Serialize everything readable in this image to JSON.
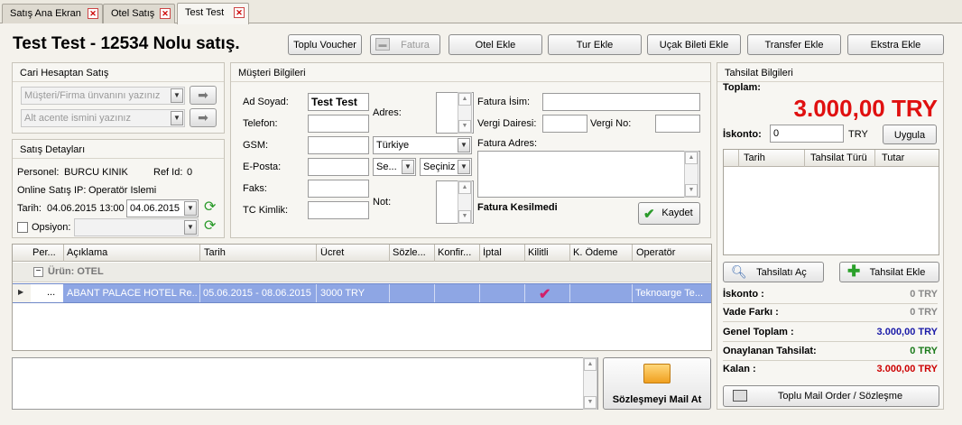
{
  "tabs": [
    {
      "label": "Satış Ana Ekran"
    },
    {
      "label": "Otel Satış"
    },
    {
      "label": "Test Test"
    }
  ],
  "page_title": "Test Test - 12534 Nolu satış.",
  "toolbar": {
    "toplu_voucher": "Toplu Voucher",
    "fatura": "Fatura",
    "otel_ekle": "Otel Ekle",
    "tur_ekle": "Tur Ekle",
    "ucak_bileti_ekle": "Uçak Bileti Ekle",
    "transfer_ekle": "Transfer Ekle",
    "ekstra_ekle": "Ekstra Ekle"
  },
  "cari": {
    "title": "Cari Hesaptan Satış",
    "firma_placeholder": "Müşteri/Firma ünvanını yazınız",
    "acente_placeholder": "Alt acente ismini yazınız"
  },
  "satis": {
    "title": "Satış Detayları",
    "personel_label": "Personel:",
    "personel_value": "BURCU KINIK",
    "refid_label": "Ref Id:",
    "refid_value": "0",
    "online_label": "Online Satış IP:",
    "online_value": "Operatör Islemi",
    "tarih_label": "Tarih:",
    "tarih_value": "04.06.2015 13:00",
    "tarih_input": "04.06.2015",
    "opsiyon_label": "Opsiyon:"
  },
  "musteri": {
    "title": "Müşteri Bilgileri",
    "ad_soyad_label": "Ad Soyad:",
    "ad_soyad_value": "Test Test",
    "telefon_label": "Telefon:",
    "gsm_label": "GSM:",
    "eposta_label": "E-Posta:",
    "faks_label": "Faks:",
    "tc_label": "TC Kimlik:",
    "adres_label": "Adres:",
    "not_label": "Not:",
    "ulke_value": "Türkiye",
    "se_value": "Se...",
    "seciniz_value": "Seçiniz",
    "fatura_isim_label": "Fatura İsim:",
    "vergi_dairesi_label": "Vergi Dairesi:",
    "vergi_no_label": "Vergi No:",
    "fatura_adres_label": "Fatura Adres:",
    "fatura_status": "Fatura Kesilmedi",
    "kaydet": "Kaydet"
  },
  "tahsilat": {
    "title": "Tahsilat Bilgileri",
    "toplam_label": "Toplam:",
    "toplam_value": "3.000,00 TRY",
    "iskonto_label": "İskonto:",
    "iskonto_value": "0",
    "iskonto_unit": "TRY",
    "uygula": "Uygula",
    "columns": [
      "Tarih",
      "Tahsilat Türü",
      "Tutar"
    ],
    "tahsilati_ac": "Tahsilatı Aç",
    "tahsilat_ekle": "Tahsilat Ekle",
    "summary": [
      {
        "label": "İskonto :",
        "value": "0 TRY",
        "color": "#888888"
      },
      {
        "label": "Vade Farkı :",
        "value": "0 TRY",
        "color": "#888888"
      },
      {
        "label": "Genel Toplam :",
        "value": "3.000,00 TRY",
        "color": "#1a1aa8"
      },
      {
        "label": "Onaylanan Tahsilat:",
        "value": "0 TRY",
        "color": "#1a7a1a"
      },
      {
        "label": "Kalan :",
        "value": "3.000,00 TRY",
        "color": "#cc0000"
      }
    ],
    "toplu_mail": "Toplu Mail Order / Sözleşme"
  },
  "products": {
    "columns": [
      "Per...",
      "Açıklama",
      "Tarih",
      "Ücret",
      "Sözle...",
      "Konfir...",
      "İptal",
      "Kilitli",
      "K. Ödeme",
      "Operatör"
    ],
    "group_label": "Ürün: OTEL",
    "row": {
      "per": "...",
      "aciklama": "ABANT PALACE HOTEL  Re...",
      "tarih": "05.06.2015 - 08.06.2015",
      "ucret": "3000 TRY",
      "operator": "Teknoarge Te..."
    }
  },
  "mail_button": "Sözleşmeyi Mail At",
  "colors": {
    "accent_red": "#e01010",
    "row_selected": "#8ea6e4"
  }
}
